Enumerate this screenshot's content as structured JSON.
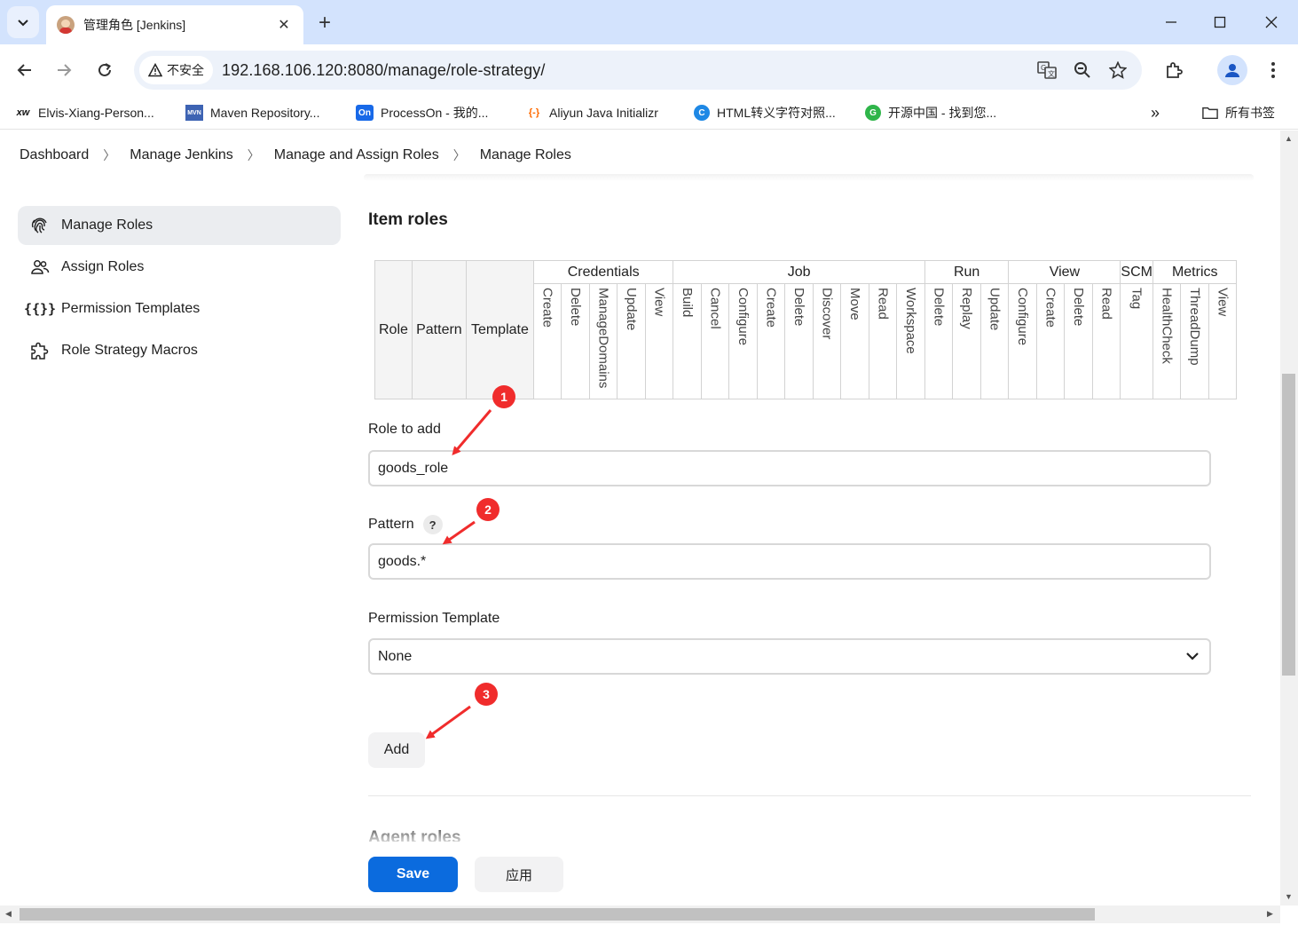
{
  "browser": {
    "tab_title": "管理角色 [Jenkins]",
    "new_tab": "+",
    "security_label": "不安全",
    "url": "192.168.106.120:8080/manage/role-strategy/",
    "bookmarks": [
      {
        "icon": "xw",
        "label": "Elvis-Xiang-Person..."
      },
      {
        "icon": "MVN",
        "label": "Maven Repository..."
      },
      {
        "icon": "On",
        "label": "ProcessOn - 我的..."
      },
      {
        "icon": "{-}",
        "label": "Aliyun Java Initializr"
      },
      {
        "icon": "C",
        "label": "HTML转义字符对照..."
      },
      {
        "icon": "G",
        "label": "开源中国 - 找到您..."
      }
    ],
    "bookmarks_overflow": "»",
    "all_bookmarks": "所有书签"
  },
  "breadcrumb": [
    "Dashboard",
    "Manage Jenkins",
    "Manage and Assign Roles",
    "Manage Roles"
  ],
  "sidebar": [
    {
      "label": "Manage Roles",
      "icon": "fingerprint-icon",
      "active": true
    },
    {
      "label": "Assign Roles",
      "icon": "people-icon",
      "active": false
    },
    {
      "label": "Permission Templates",
      "icon": "braces-icon",
      "active": false
    },
    {
      "label": "Role Strategy Macros",
      "icon": "puzzle-icon",
      "active": false
    }
  ],
  "main": {
    "item_roles_title": "Item roles",
    "table": {
      "fixed_headers": [
        "Role",
        "Pattern",
        "Template"
      ],
      "groups": [
        {
          "name": "Credentials",
          "perms": [
            "Create",
            "Delete",
            "ManageDomains",
            "Update",
            "View"
          ]
        },
        {
          "name": "Job",
          "perms": [
            "Build",
            "Cancel",
            "Configure",
            "Create",
            "Delete",
            "Discover",
            "Move",
            "Read",
            "Workspace"
          ]
        },
        {
          "name": "Run",
          "perms": [
            "Delete",
            "Replay",
            "Update"
          ]
        },
        {
          "name": "View",
          "perms": [
            "Configure",
            "Create",
            "Delete",
            "Read"
          ]
        },
        {
          "name": "SCM",
          "perms": [
            "Tag"
          ]
        },
        {
          "name": "Metrics",
          "perms": [
            "HealthCheck",
            "ThreadDump",
            "View"
          ]
        }
      ]
    },
    "role_to_add_label": "Role to add",
    "role_to_add_value": "goods_role",
    "pattern_label": "Pattern",
    "pattern_help": "?",
    "pattern_value": "goods.*",
    "permission_template_label": "Permission Template",
    "permission_template_value": "None",
    "add_button": "Add",
    "agent_roles_title": "Agent roles"
  },
  "footer": {
    "save": "Save",
    "apply": "应用"
  },
  "annotations": [
    "1",
    "2",
    "3"
  ],
  "colors": {
    "tabstrip": "#d3e3fd",
    "primary_button": "#0b6bde",
    "annotation_red": "#f02c2c"
  }
}
